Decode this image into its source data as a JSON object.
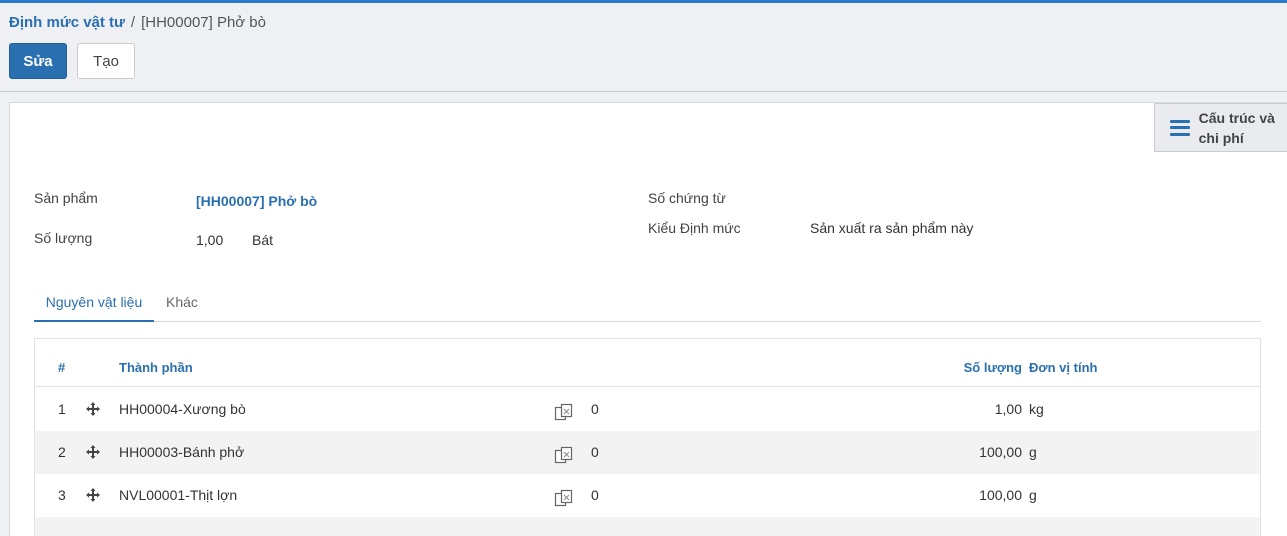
{
  "breadcrumb": {
    "parent": "Định mức vật tư",
    "separator": "/",
    "current": "[HH00007] Phở bò"
  },
  "actions": {
    "edit": "Sửa",
    "create": "Tạo"
  },
  "side_button": {
    "line1": "Cấu trúc và",
    "line2": "chi phí",
    "icon": "menu-icon"
  },
  "form": {
    "product_label": "Sản phẩm",
    "product_value": "[HH00007] Phở bò",
    "quantity_label": "Số lượng",
    "quantity_value": "1,00",
    "quantity_unit": "Bát",
    "doc_no_label": "Số chứng từ",
    "doc_no_value": "",
    "type_label": "Kiểu Định mức",
    "type_value": "Sản xuất ra sản phẩm này"
  },
  "tabs": [
    "Nguyên vật liệu",
    "Khác"
  ],
  "table": {
    "headers": {
      "num": "#",
      "component": "Thành phần",
      "quantity": "Số lượng",
      "unit": "Đơn vị tính"
    },
    "rows": [
      {
        "num": "1",
        "component": "HH00004-Xương bò",
        "extra": "0",
        "quantity": "1,00",
        "unit": "kg"
      },
      {
        "num": "2",
        "component": "HH00003-Bánh phở",
        "extra": "0",
        "quantity": "100,00",
        "unit": "g"
      },
      {
        "num": "3",
        "component": "NVL00001-Thịt lợn",
        "extra": "0",
        "quantity": "100,00",
        "unit": "g"
      }
    ]
  },
  "colors": {
    "accent": "#2a6fb0",
    "topline": "#2d7bd0",
    "background": "#eef0f4",
    "row_alt": "#f3f3f4"
  }
}
